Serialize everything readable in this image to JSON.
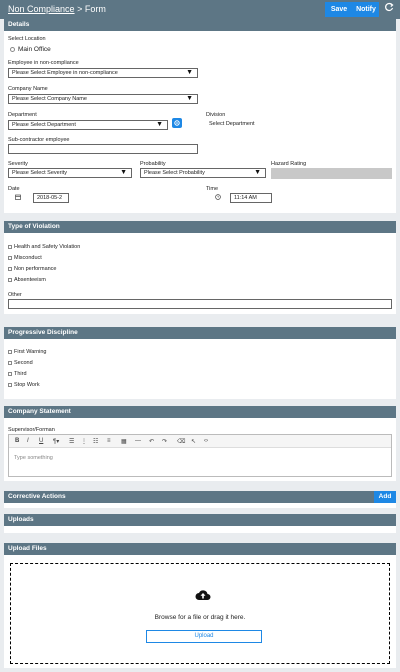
{
  "header": {
    "breadcrumb_link": "Non Compliance",
    "breadcrumb_sep": ">",
    "breadcrumb_current": "Form",
    "save_label": "Save",
    "notify_label": "Notify"
  },
  "details": {
    "title": "Details",
    "select_location_label": "Select Location",
    "location_option": "Main Office",
    "employee_label": "Employee in non-compliance",
    "employee_value": "Please Select Employee in non-compliance",
    "company_label": "Company Name",
    "company_value": "Please Select Company Name",
    "department_label": "Department",
    "department_value": "Please Select Department",
    "division_label": "Division",
    "division_value": "Select Department",
    "subcontractor_label": "Sub-contractor employee",
    "subcontractor_value": "",
    "severity_label": "Severity",
    "severity_value": "Please Select Severity",
    "probability_label": "Probability",
    "probability_value": "Please Select Probability",
    "hazard_label": "Hazard Rating",
    "date_label": "Date",
    "date_value": "2018-05-2",
    "time_label": "Time",
    "time_value": "11:14 AM"
  },
  "violation": {
    "title": "Type of Violation",
    "items": [
      "Health and Safety Violation",
      "Misconduct",
      "Non performance",
      "Absenteeism"
    ],
    "other_label": "Other"
  },
  "discipline": {
    "title": "Progressive Discipline",
    "items": [
      "First Warning",
      "Second",
      "Third",
      "Stop Work"
    ]
  },
  "statement": {
    "title": "Company Statement",
    "supervisor_label": "Supervisor/Forman",
    "placeholder": "Type something"
  },
  "corrective": {
    "title": "Corrective Actions",
    "add_label": "Add"
  },
  "uploads": {
    "title": "Uploads"
  },
  "upload_files": {
    "title": "Upload Files",
    "browse_text": "Browse for a file or drag it here.",
    "upload_label": "Upload"
  },
  "colors": {
    "header": "#5d7685",
    "accent": "#1e88e5",
    "hazard": "#c8c8c8"
  }
}
